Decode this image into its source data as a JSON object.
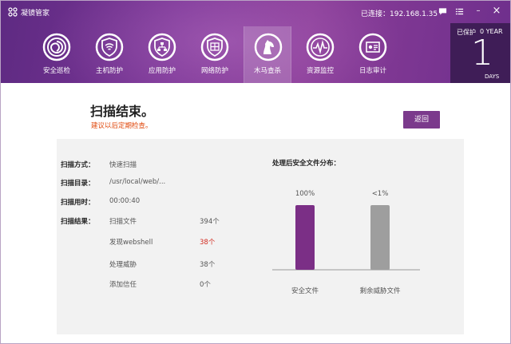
{
  "window": {
    "app_title": "凝镜管家",
    "connection": "已连接：192.168.1.35",
    "chat_icon": "chat-icon",
    "menu_icon": "menu-icon",
    "minimize_label": "–",
    "close_label": "×"
  },
  "nav": {
    "items": [
      {
        "label": "安全巡检",
        "icon": "spiral-icon"
      },
      {
        "label": "主机防护",
        "icon": "shield-wifi-icon"
      },
      {
        "label": "应用防护",
        "icon": "shield-network-icon"
      },
      {
        "label": "网络防护",
        "icon": "shield-grid-icon"
      },
      {
        "label": "木马查杀",
        "icon": "horse-icon",
        "active": true
      },
      {
        "label": "资源监控",
        "icon": "pulse-icon"
      },
      {
        "label": "日志审计",
        "icon": "log-icon"
      }
    ]
  },
  "protect": {
    "label": "已保护",
    "unit": "0 YEAR",
    "days": "1",
    "days_label": "DAYS"
  },
  "result": {
    "title": "扫描结束。",
    "hint": "建议以后定期检查。",
    "back_label": "返回"
  },
  "details": {
    "mode_label": "扫描方式：",
    "mode_value": "快速扫描",
    "dir_label": "扫描目录：",
    "dir_value": "/usr/local/web/...",
    "time_label": "扫描用时：",
    "time_value": "00:00:40",
    "result_label": "扫描结果：",
    "results": [
      {
        "name": "扫描文件",
        "value": "394个",
        "highlight": false
      },
      {
        "name": "发现webshell",
        "value": "38个",
        "highlight": true
      },
      {
        "name": "处理威胁",
        "value": "38个",
        "highlight": false
      },
      {
        "name": "添加信任",
        "value": "0个",
        "highlight": false
      }
    ]
  },
  "chart_data": {
    "type": "bar",
    "title": "处理后安全文件分布：",
    "categories": [
      "安全文件",
      "剩余威胁文件"
    ],
    "value_labels": [
      "100%",
      "<1%"
    ],
    "colors": [
      "#7b2f86",
      "#9e9e9e"
    ]
  },
  "colors": {
    "accent": "#7b3a8c",
    "warning": "#e0480c",
    "danger": "#d22a1f"
  }
}
